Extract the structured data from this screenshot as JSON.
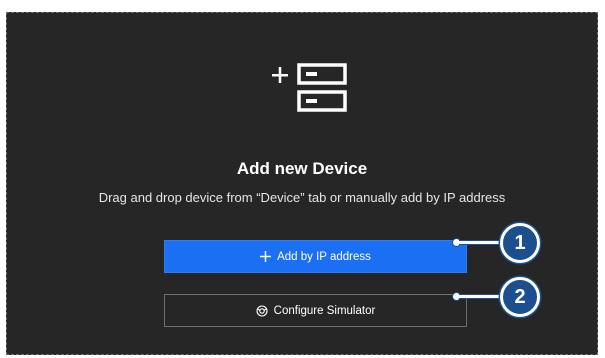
{
  "empty_state": {
    "title": "Add new Device",
    "subtitle": "Drag and drop device from “Device” tab or manually add by IP address"
  },
  "buttons": {
    "add_by_ip": "Add by IP address",
    "configure_simulator": "Configure Simulator"
  },
  "callouts": [
    "1",
    "2"
  ],
  "icons": {
    "hero": "add-device-icon",
    "add": "plus-icon",
    "simulator": "simulator-icon"
  },
  "colors": {
    "panel_bg": "#262626",
    "primary": "#1a6ff2",
    "callout": "#1b4f8f"
  }
}
